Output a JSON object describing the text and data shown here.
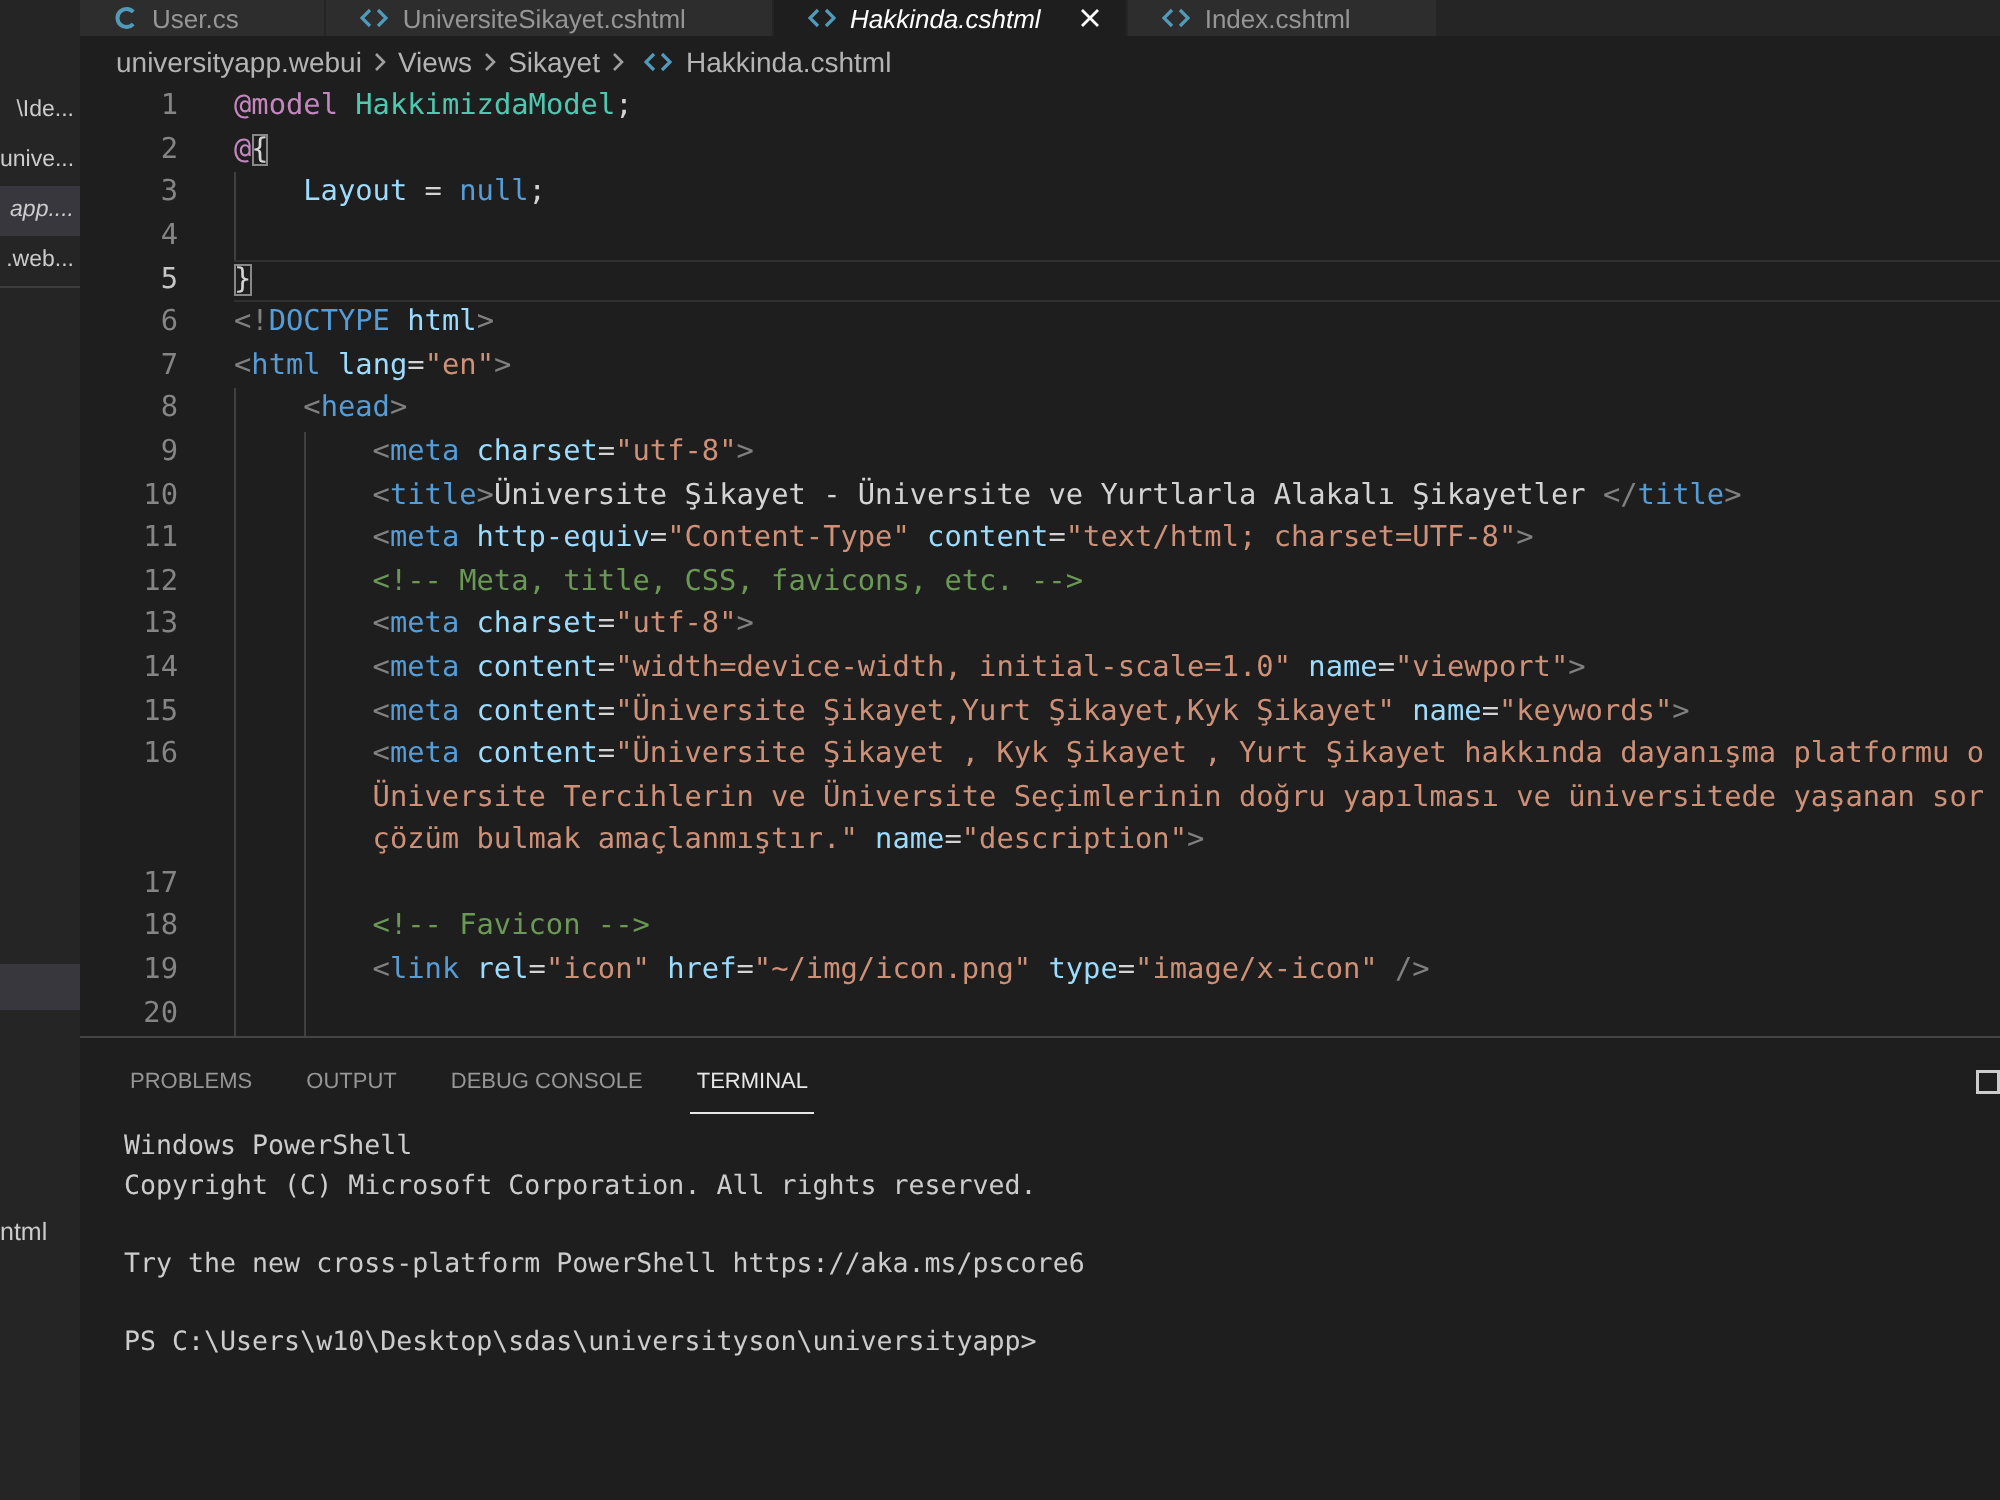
{
  "tabs": [
    {
      "label": "User.cs",
      "kind": "cs",
      "selected": false,
      "preview": false
    },
    {
      "label": "UniversiteSikayet.cshtml",
      "kind": "cshtml",
      "selected": false,
      "preview": false
    },
    {
      "label": "Hakkinda.cshtml",
      "kind": "cshtml",
      "selected": true,
      "preview": true
    },
    {
      "label": "Index.cshtml",
      "kind": "cshtml",
      "selected": false,
      "preview": false
    }
  ],
  "sidebar": {
    "open_editors": [
      {
        "label": "\\Ide...",
        "selected": false,
        "preview": false
      },
      {
        "label": "unive...",
        "selected": false,
        "preview": false
      },
      {
        "label": "app....",
        "selected": true,
        "preview": true
      },
      {
        "label": ".web...",
        "selected": false,
        "preview": false
      }
    ],
    "explorer_rows": [
      {
        "selected": true
      },
      {
        "label": "ntml",
        "selected": false
      }
    ]
  },
  "breadcrumb": [
    {
      "label": "universityapp.webui",
      "kind": "folder"
    },
    {
      "label": "Views",
      "kind": "folder"
    },
    {
      "label": "Sikayet",
      "kind": "folder"
    },
    {
      "label": "Hakkinda.cshtml",
      "kind": "file"
    }
  ],
  "editor": {
    "lines": [
      {
        "number": "1",
        "current": false,
        "visual_rows": [
          {
            "tokens": [
              {
                "kind": "directive",
                "text": "@model"
              },
              {
                "kind": "type",
                "text": " HakkimizdaModel"
              },
              {
                "kind": "plain",
                "text": ";"
              }
            ]
          }
        ]
      },
      {
        "number": "2",
        "current": false,
        "visual_rows": [
          {
            "tokens": [
              {
                "kind": "directive",
                "text": "@"
              },
              {
                "kind": "bracket_match",
                "text": "{"
              }
            ]
          }
        ],
        "children": [
          {
            "number": "3",
            "current": false,
            "visual_rows": [
              {
                "tokens": [
                  {
                    "kind": "variable",
                    "text": "Layout"
                  },
                  {
                    "kind": "plain",
                    "text": " = "
                  },
                  {
                    "kind": "keyword",
                    "text": "null"
                  },
                  {
                    "kind": "plain",
                    "text": ";"
                  }
                ]
              }
            ]
          },
          {
            "number": "4",
            "current": false
          }
        ]
      },
      {
        "number": "5",
        "current": true,
        "visual_rows": [
          {
            "tokens": [
              {
                "kind": "bracket_match",
                "text": "}"
              }
            ]
          }
        ]
      },
      {
        "number": "6",
        "current": false,
        "visual_rows": [
          {
            "tokens": [
              {
                "kind": "punct",
                "text": "<!"
              },
              {
                "kind": "tag",
                "text": "DOCTYPE"
              },
              {
                "kind": "attr",
                "text": " html"
              },
              {
                "kind": "punct",
                "text": ">"
              }
            ]
          }
        ]
      },
      {
        "number": "7",
        "current": false,
        "visual_rows": [
          {
            "tokens": [
              {
                "kind": "punct",
                "text": "<"
              },
              {
                "kind": "tag",
                "text": "html"
              },
              {
                "kind": "attr",
                "text": " lang"
              },
              {
                "kind": "plain",
                "text": "="
              },
              {
                "kind": "string",
                "text": "\"en\""
              },
              {
                "kind": "punct",
                "text": ">"
              }
            ]
          }
        ],
        "children": [
          {
            "number": "8",
            "current": false,
            "visual_rows": [
              {
                "tokens": [
                  {
                    "kind": "punct",
                    "text": "<"
                  },
                  {
                    "kind": "tag",
                    "text": "head"
                  },
                  {
                    "kind": "punct",
                    "text": ">"
                  }
                ]
              }
            ],
            "children": [
              {
                "number": "9",
                "current": false,
                "visual_rows": [
                  {
                    "tokens": [
                      {
                        "kind": "punct",
                        "text": "<"
                      },
                      {
                        "kind": "tag",
                        "text": "meta"
                      },
                      {
                        "kind": "attr",
                        "text": " charset"
                      },
                      {
                        "kind": "plain",
                        "text": "="
                      },
                      {
                        "kind": "string",
                        "text": "\"utf-8\""
                      },
                      {
                        "kind": "punct",
                        "text": ">"
                      }
                    ]
                  }
                ]
              },
              {
                "number": "10",
                "current": false,
                "visual_rows": [
                  {
                    "tokens": [
                      {
                        "kind": "punct",
                        "text": "<"
                      },
                      {
                        "kind": "tag",
                        "text": "title"
                      },
                      {
                        "kind": "punct",
                        "text": ">"
                      },
                      {
                        "kind": "plain",
                        "text": "Üniversite Şikayet - Üniversite ve Yurtlarla Alakalı Şikayetler "
                      },
                      {
                        "kind": "punct",
                        "text": "</"
                      },
                      {
                        "kind": "tag",
                        "text": "title"
                      },
                      {
                        "kind": "punct",
                        "text": ">"
                      }
                    ]
                  }
                ]
              },
              {
                "number": "11",
                "current": false,
                "visual_rows": [
                  {
                    "tokens": [
                      {
                        "kind": "punct",
                        "text": "<"
                      },
                      {
                        "kind": "tag",
                        "text": "meta"
                      },
                      {
                        "kind": "attr",
                        "text": " http-equiv"
                      },
                      {
                        "kind": "plain",
                        "text": "="
                      },
                      {
                        "kind": "string",
                        "text": "\"Content-Type\""
                      },
                      {
                        "kind": "attr",
                        "text": " content"
                      },
                      {
                        "kind": "plain",
                        "text": "="
                      },
                      {
                        "kind": "string",
                        "text": "\"text/html; charset=UTF-8\""
                      },
                      {
                        "kind": "punct",
                        "text": ">"
                      }
                    ]
                  }
                ]
              },
              {
                "number": "12",
                "current": false,
                "visual_rows": [
                  {
                    "tokens": [
                      {
                        "kind": "comment",
                        "text": "<!-- Meta, title, CSS, favicons, etc. -->"
                      }
                    ]
                  }
                ]
              },
              {
                "number": "13",
                "current": false,
                "visual_rows": [
                  {
                    "tokens": [
                      {
                        "kind": "punct",
                        "text": "<"
                      },
                      {
                        "kind": "tag",
                        "text": "meta"
                      },
                      {
                        "kind": "attr",
                        "text": " charset"
                      },
                      {
                        "kind": "plain",
                        "text": "="
                      },
                      {
                        "kind": "string",
                        "text": "\"utf-8\""
                      },
                      {
                        "kind": "punct",
                        "text": ">"
                      }
                    ]
                  }
                ]
              },
              {
                "number": "14",
                "current": false,
                "visual_rows": [
                  {
                    "tokens": [
                      {
                        "kind": "punct",
                        "text": "<"
                      },
                      {
                        "kind": "tag",
                        "text": "meta"
                      },
                      {
                        "kind": "attr",
                        "text": " content"
                      },
                      {
                        "kind": "plain",
                        "text": "="
                      },
                      {
                        "kind": "string",
                        "text": "\"width=device-width, initial-scale=1.0\""
                      },
                      {
                        "kind": "attr",
                        "text": " name"
                      },
                      {
                        "kind": "plain",
                        "text": "="
                      },
                      {
                        "kind": "string",
                        "text": "\"viewport\""
                      },
                      {
                        "kind": "punct",
                        "text": ">"
                      }
                    ]
                  }
                ]
              },
              {
                "number": "15",
                "current": false,
                "visual_rows": [
                  {
                    "tokens": [
                      {
                        "kind": "punct",
                        "text": "<"
                      },
                      {
                        "kind": "tag",
                        "text": "meta"
                      },
                      {
                        "kind": "attr",
                        "text": " content"
                      },
                      {
                        "kind": "plain",
                        "text": "="
                      },
                      {
                        "kind": "string",
                        "text": "\"Üniversite Şikayet,Yurt Şikayet,Kyk Şikayet\""
                      },
                      {
                        "kind": "attr",
                        "text": " name"
                      },
                      {
                        "kind": "plain",
                        "text": "="
                      },
                      {
                        "kind": "string",
                        "text": "\"keywords\""
                      },
                      {
                        "kind": "punct",
                        "text": ">"
                      }
                    ]
                  }
                ]
              },
              {
                "number": "16",
                "current": false,
                "visual_rows": [
                  {
                    "tokens": [
                      {
                        "kind": "punct",
                        "text": "<"
                      },
                      {
                        "kind": "tag",
                        "text": "meta"
                      },
                      {
                        "kind": "attr",
                        "text": " content"
                      },
                      {
                        "kind": "plain",
                        "text": "="
                      },
                      {
                        "kind": "string",
                        "text": "\"Üniversite Şikayet , Kyk Şikayet , Yurt Şikayet hakkında dayanışma platformu o"
                      }
                    ]
                  },
                  {
                    "tokens": [
                      {
                        "kind": "string",
                        "text": "Üniversite Tercihlerin ve Üniversite Seçimlerinin doğru yapılması ve üniversitede yaşanan sor"
                      }
                    ]
                  },
                  {
                    "tokens": [
                      {
                        "kind": "string",
                        "text": "çözüm bulmak amaçlanmıştır.\""
                      },
                      {
                        "kind": "attr",
                        "text": " name"
                      },
                      {
                        "kind": "plain",
                        "text": "="
                      },
                      {
                        "kind": "string",
                        "text": "\"description\""
                      },
                      {
                        "kind": "punct",
                        "text": ">"
                      }
                    ]
                  }
                ]
              },
              {
                "number": "17",
                "current": false
              },
              {
                "number": "18",
                "current": false,
                "visual_rows": [
                  {
                    "tokens": [
                      {
                        "kind": "comment",
                        "text": "<!-- Favicon -->"
                      }
                    ]
                  }
                ]
              },
              {
                "number": "19",
                "current": false,
                "visual_rows": [
                  {
                    "tokens": [
                      {
                        "kind": "punct",
                        "text": "<"
                      },
                      {
                        "kind": "tag",
                        "text": "link"
                      },
                      {
                        "kind": "attr",
                        "text": " rel"
                      },
                      {
                        "kind": "plain",
                        "text": "="
                      },
                      {
                        "kind": "string",
                        "text": "\"icon\""
                      },
                      {
                        "kind": "attr",
                        "text": " href"
                      },
                      {
                        "kind": "plain",
                        "text": "="
                      },
                      {
                        "kind": "string",
                        "text": "\"~/img/icon.png\""
                      },
                      {
                        "kind": "attr",
                        "text": " type"
                      },
                      {
                        "kind": "plain",
                        "text": "="
                      },
                      {
                        "kind": "string",
                        "text": "\"image/x-icon\""
                      },
                      {
                        "kind": "punct",
                        "text": " />"
                      }
                    ]
                  }
                ]
              },
              {
                "number": "20",
                "current": false
              }
            ]
          }
        ]
      }
    ]
  },
  "panel": {
    "tabs": [
      {
        "label": "PROBLEMS",
        "selected": false
      },
      {
        "label": "OUTPUT",
        "selected": false
      },
      {
        "label": "DEBUG CONSOLE",
        "selected": false
      },
      {
        "label": "TERMINAL",
        "selected": true
      }
    ],
    "terminal": [
      [
        "Windows PowerShell",
        "Copyright (C) Microsoft Corporation. All rights reserved."
      ],
      [
        "Try the new cross-platform PowerShell https://aka.ms/pscore6"
      ],
      [
        "PS C:\\Users\\w10\\Desktop\\sdas\\universityson\\universityapp>"
      ]
    ]
  }
}
